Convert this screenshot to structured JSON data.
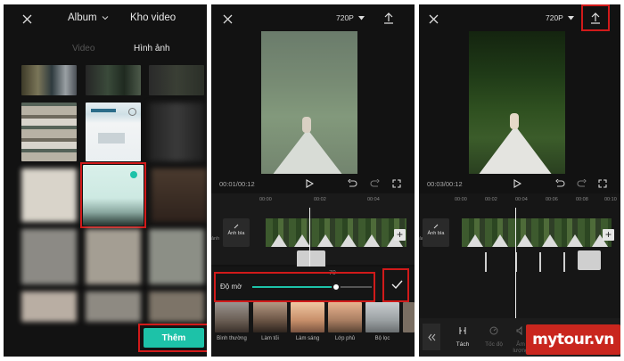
{
  "panel1": {
    "tabs": [
      "Album",
      "Kho video"
    ],
    "subtabs": [
      "Video",
      "Hình ảnh"
    ],
    "add_button": "Thêm"
  },
  "panel2": {
    "quality": "720P",
    "time": "00:01/00:12",
    "ruler": [
      "00:00",
      "00:02",
      "00:04"
    ],
    "cover_label": "Ảnh bìa",
    "side_label": "ảnh",
    "opacity_value": "70",
    "opacity_label": "Độ mờ",
    "opacity_fraction": 0.7,
    "filters": [
      "Bình thường",
      "Làm tối",
      "Làm sáng",
      "Lớp phủ",
      "Bộ lọc"
    ]
  },
  "panel3": {
    "quality": "720P",
    "time": "00:03/00:12",
    "ruler": [
      "00:00",
      "00:02",
      "00:04",
      "00:06",
      "00:08",
      "00:10"
    ],
    "cover_label": "Ảnh bìa",
    "side_label": "ảnh",
    "tools": [
      "Tách",
      "Tốc độ",
      "Âm lượng"
    ]
  },
  "watermark": "mytour.vn",
  "colors": {
    "accent": "#1dc2a8",
    "highlight": "#d11a1a",
    "panel_bg": "#121212"
  }
}
